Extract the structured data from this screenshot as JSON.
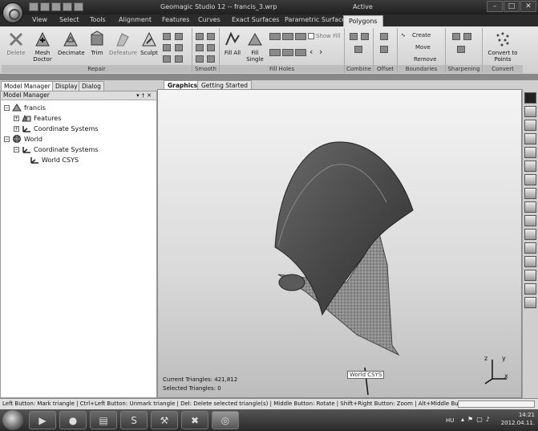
{
  "window": {
    "title": "Geomagic Studio 12 -- francis_3.wrp",
    "status": "Active",
    "controls": [
      "–",
      "□",
      "✕"
    ]
  },
  "ribbon_tabs": [
    "View",
    "Select",
    "Tools",
    "Alignment",
    "Features",
    "Curves",
    "Exact Surfaces",
    "Parametric Surfaces",
    "Polygons"
  ],
  "active_tab": "Polygons",
  "ribbon": {
    "repair": {
      "label": "Repair",
      "buttons": [
        "Delete",
        "Mesh Doctor",
        "Decimate",
        "Trim",
        "Defeature",
        "Sculpt"
      ]
    },
    "smooth": {
      "label": "Smooth"
    },
    "fill_holes": {
      "label": "Fill Holes",
      "buttons": [
        "Fill All",
        "Fill Single"
      ],
      "show_fill": "Show Fill"
    },
    "combine": {
      "label": "Combine"
    },
    "offset": {
      "label": "Offset"
    },
    "boundaries": {
      "label": "Boundaries",
      "items": [
        "Create",
        "Move",
        "Remove"
      ]
    },
    "sharpening": {
      "label": "Sharpening"
    },
    "convert": {
      "label": "Convert",
      "button": "Convert to Points"
    }
  },
  "panel_tabs": [
    "Model Manager",
    "Display",
    "Dialog"
  ],
  "model_manager": {
    "title": "Model Manager",
    "tree": [
      {
        "label": "francis",
        "toggle": "−",
        "icon": "mesh-icon"
      },
      {
        "label": "Features",
        "toggle": "+",
        "icon": "features-icon"
      },
      {
        "label": "Coordinate Systems",
        "toggle": "+",
        "icon": "csys-icon"
      },
      {
        "label": "World",
        "toggle": "−",
        "icon": "globe-icon"
      },
      {
        "label": "Coordinate Systems",
        "toggle": "−",
        "icon": "csys-icon"
      },
      {
        "label": "World CSYS",
        "toggle": "",
        "icon": "csys-icon"
      }
    ]
  },
  "graphics_tabs": [
    "Graphics",
    "Getting Started"
  ],
  "viewport": {
    "current_triangles": "Current Triangles: 421,812",
    "selected_triangles": "Selected Triangles: 0",
    "csys_label": "World CSYS",
    "axis_labels": {
      "x": "x",
      "y": "y",
      "z": "z"
    }
  },
  "statusbar": {
    "text": "Left Button: Mark triangle | Ctrl+Left Button: Unmark triangle | Del: Delete selected triangle(s) | Middle Button: Rotate | Shift+Right Button: Zoom | Alt+Middle Butt..."
  },
  "taskbar": {
    "apps": [
      "media-player-icon",
      "firefox-icon",
      "explorer-icon",
      "skype-icon",
      "tools-icon",
      "x-app-icon",
      "geomagic-icon"
    ],
    "language": "HU",
    "time": "14:21",
    "date": "2012.04.11."
  }
}
